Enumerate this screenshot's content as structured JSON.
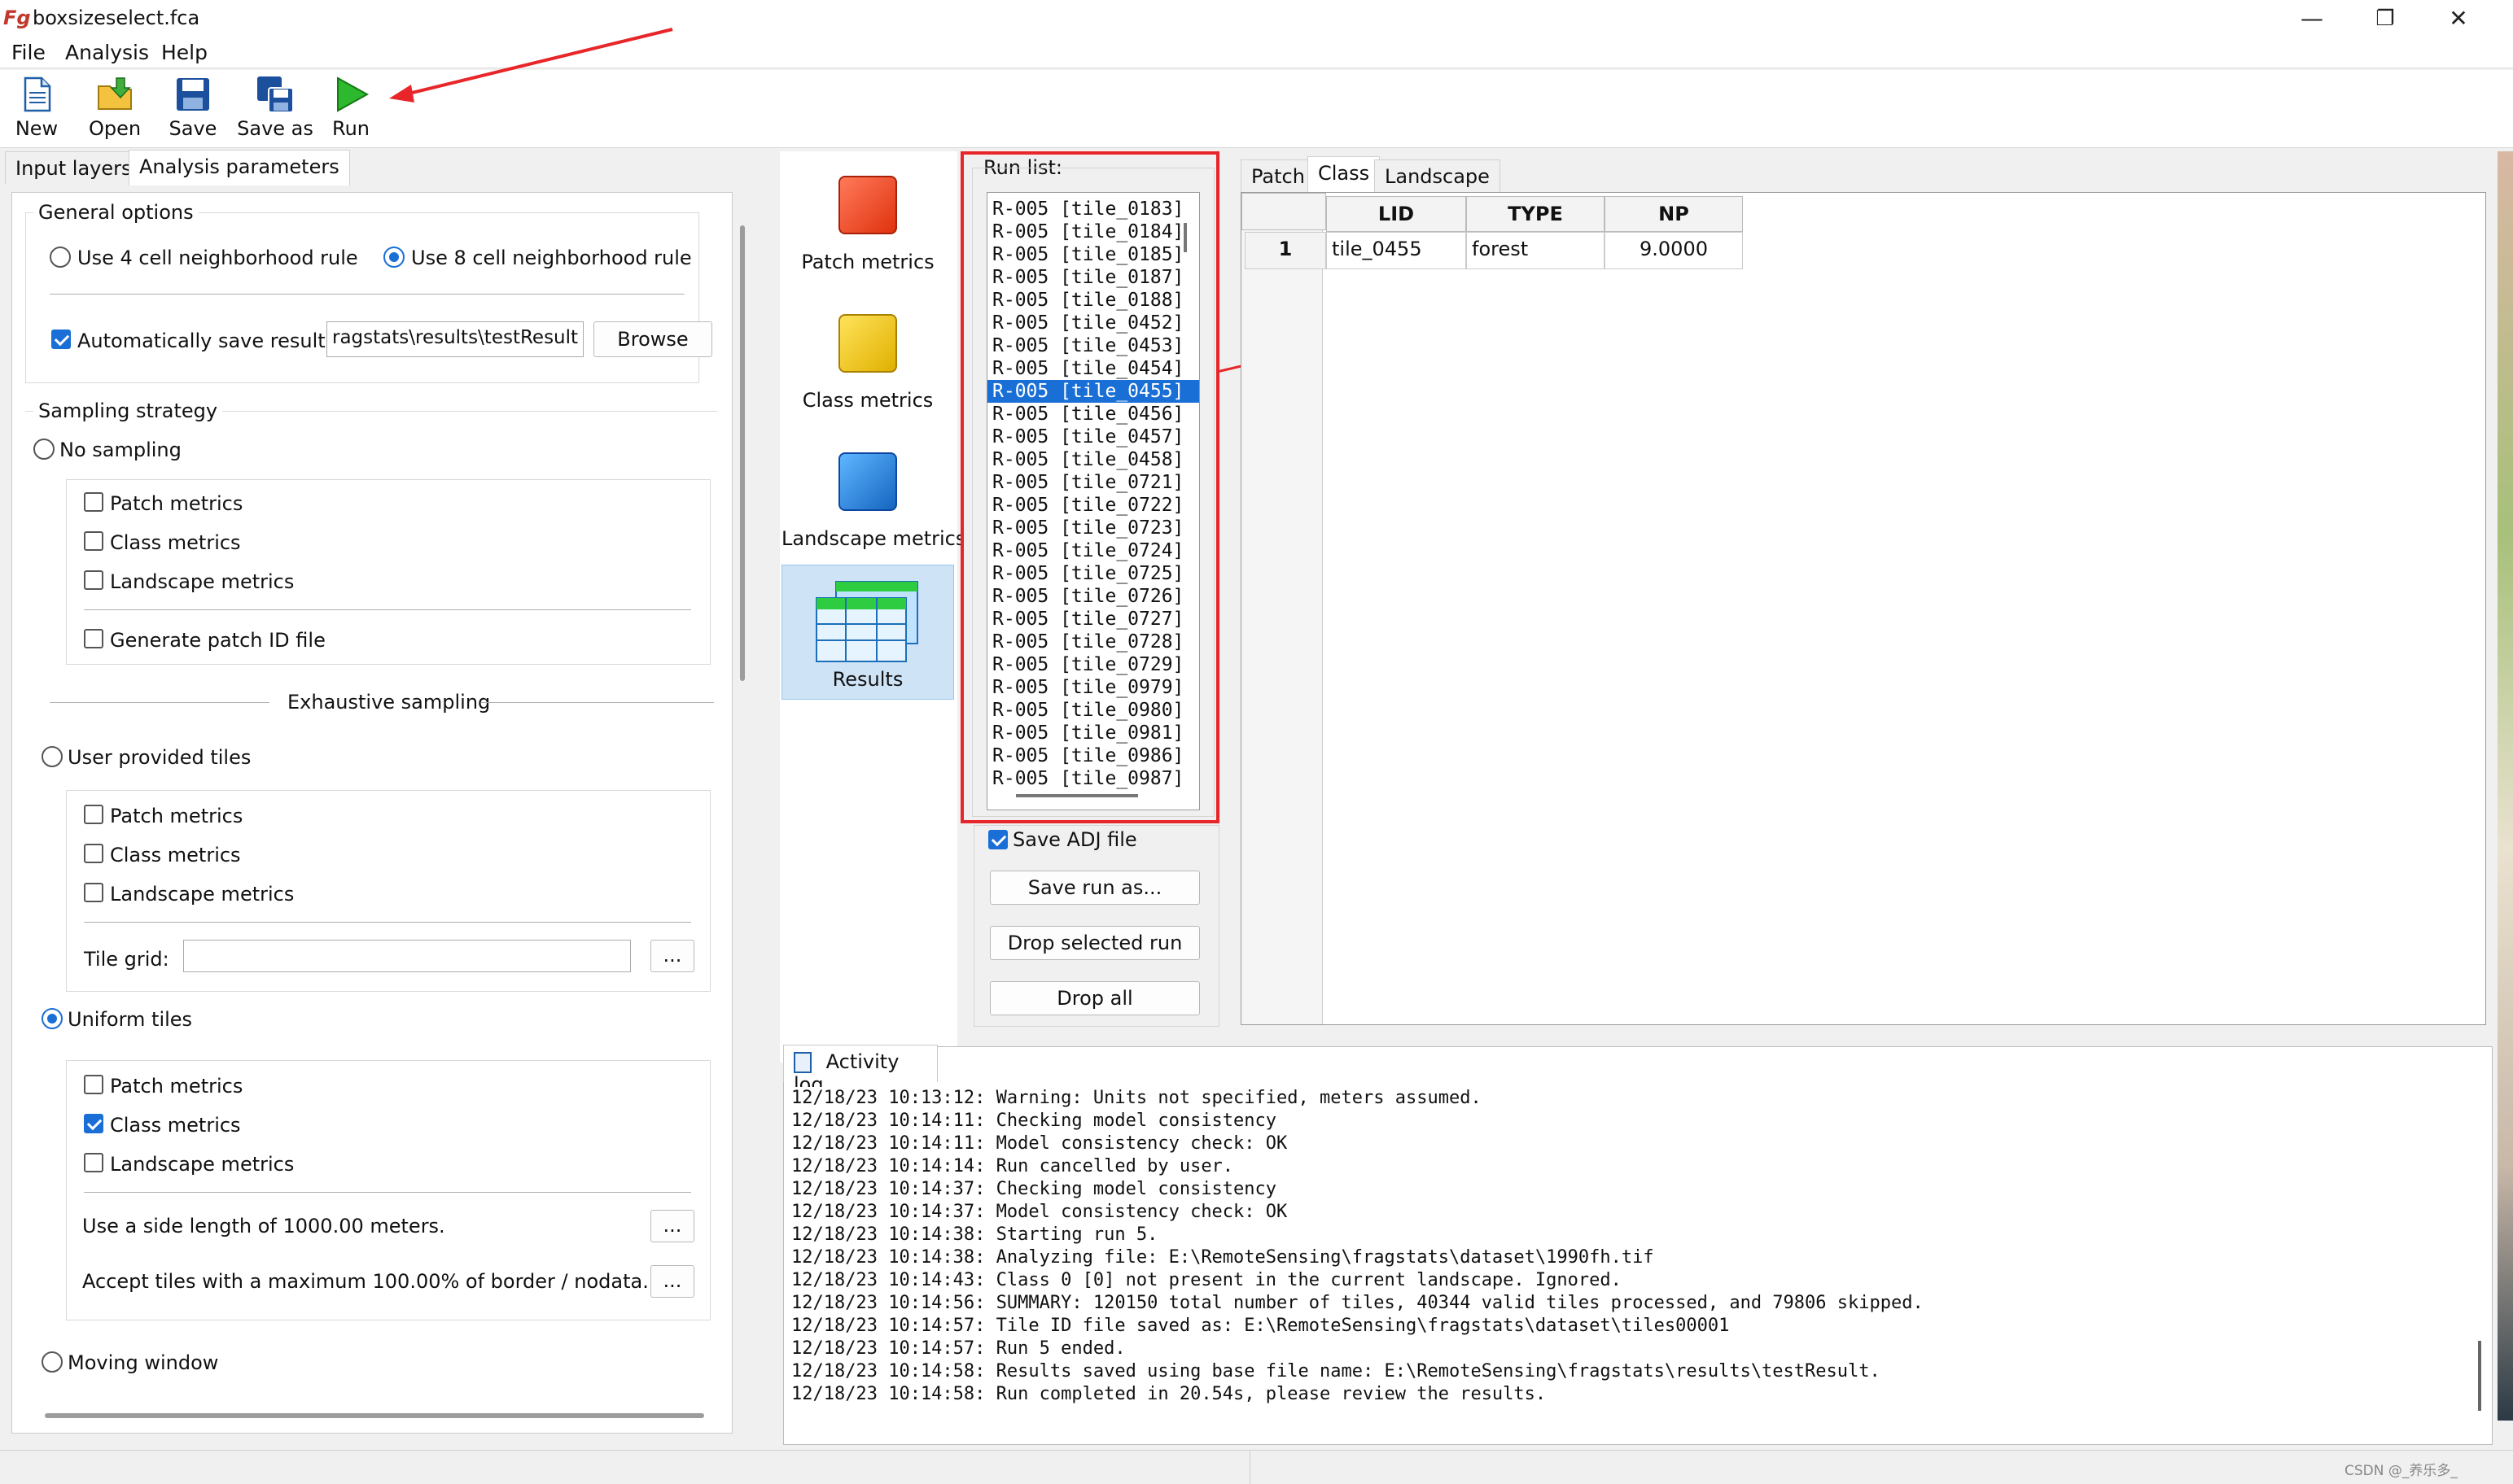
{
  "window": {
    "title": "boxsizeselect.fca",
    "logo": "Fg",
    "minimize": "—",
    "restore": "❐",
    "close": "✕"
  },
  "menu": [
    "File",
    "Analysis",
    "Help"
  ],
  "toolbar": {
    "new": "New",
    "open": "Open",
    "save": "Save",
    "save_as": "Save as",
    "run": "Run"
  },
  "left_tabs": [
    "Input layers",
    "Analysis parameters"
  ],
  "general": {
    "legend": "General options",
    "rule4": "Use 4 cell neighborhood rule",
    "rule8": "Use 8 cell neighborhood rule",
    "autosave": "Automatically save results",
    "save_path": "ragstats\\results\\testResult",
    "browse": "Browse"
  },
  "sampling": {
    "legend": "Sampling strategy",
    "no_sampling": "No sampling",
    "patch": "Patch metrics",
    "class": "Class metrics",
    "landscape": "Landscape metrics",
    "patch_id": "Generate patch ID file",
    "exhaustive": "Exhaustive sampling",
    "user_tiles": "User provided tiles",
    "tile_grid": "Tile grid:",
    "dots": "...",
    "uniform_tiles": "Uniform tiles",
    "side_length": "Use a side length of 1000.00 meters.",
    "accept_tiles": "Accept tiles with a maximum 100.00% of border / nodata.",
    "moving_window": "Moving window"
  },
  "metric_buttons": {
    "patch": "Patch metrics",
    "class": "Class metrics",
    "landscape": "Landscape metrics",
    "results": "Results"
  },
  "run_list": {
    "legend": "Run list:",
    "items": [
      "R-005 [tile_0183]",
      "R-005 [tile_0184]",
      "R-005 [tile_0185]",
      "R-005 [tile_0187]",
      "R-005 [tile_0188]",
      "R-005 [tile_0452]",
      "R-005 [tile_0453]",
      "R-005 [tile_0454]",
      "R-005 [tile_0455]",
      "R-005 [tile_0456]",
      "R-005 [tile_0457]",
      "R-005 [tile_0458]",
      "R-005 [tile_0721]",
      "R-005 [tile_0722]",
      "R-005 [tile_0723]",
      "R-005 [tile_0724]",
      "R-005 [tile_0725]",
      "R-005 [tile_0726]",
      "R-005 [tile_0727]",
      "R-005 [tile_0728]",
      "R-005 [tile_0729]",
      "R-005 [tile_0979]",
      "R-005 [tile_0980]",
      "R-005 [tile_0981]",
      "R-005 [tile_0986]",
      "R-005 [tile_0987]"
    ],
    "selected": "R-005 [tile_0455]",
    "save_adj": "Save ADJ file",
    "save_run": "Save run as...",
    "drop_selected": "Drop selected run",
    "drop_all": "Drop all"
  },
  "result_tabs": [
    "Patch",
    "Class",
    "Landscape"
  ],
  "result_table": {
    "headers": [
      "LID",
      "TYPE",
      "NP"
    ],
    "rows": [
      {
        "num": "1",
        "lid": "tile_0455",
        "type": "forest",
        "np": "9.0000"
      }
    ]
  },
  "activity": {
    "tab": "Activity log",
    "lines": [
      "12/18/23 10:13:12: Warning: Units not specified, meters assumed.",
      "12/18/23 10:14:11: Checking model consistency",
      "12/18/23 10:14:11: Model consistency check: OK",
      "12/18/23 10:14:14: Run cancelled by user.",
      "12/18/23 10:14:37: Checking model consistency",
      "12/18/23 10:14:37: Model consistency check: OK",
      "12/18/23 10:14:38: Starting run 5.",
      "12/18/23 10:14:38: Analyzing file: E:\\RemoteSensing\\fragstats\\dataset\\1990fh.tif",
      "12/18/23 10:14:43: Class 0 [0] not present in the current landscape. Ignored.",
      "12/18/23 10:14:56: SUMMARY: 120150 total number of tiles, 40344 valid tiles processed, and 79806 skipped.",
      "12/18/23 10:14:57: Tile ID file saved as: E:\\RemoteSensing\\fragstats\\dataset\\tiles00001",
      "12/18/23 10:14:57: Run 5 ended.",
      "12/18/23 10:14:58: Results saved using base file name: E:\\RemoteSensing\\fragstats\\results\\testResult.",
      "12/18/23 10:14:58: Run completed in 20.54s, please review the results."
    ]
  },
  "watermark": "CSDN @_养乐多_",
  "colors": {
    "accent": "#1a6fd6",
    "annotation_red": "#e8262a"
  },
  "icons": {
    "patch_square": "#f0401f",
    "class_square": "#f5c400",
    "landscape_square": "#1e88e5"
  }
}
